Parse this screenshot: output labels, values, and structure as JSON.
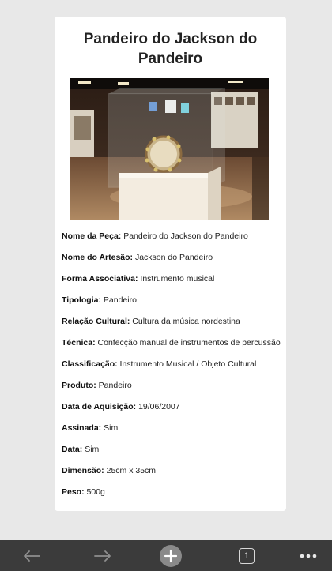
{
  "page": {
    "title": "Pandeiro do Jackson do Pandeiro"
  },
  "photo": {
    "subject": "pandeiro-in-glass-display-case"
  },
  "fields": [
    {
      "label": "Nome da Peça:",
      "value": "Pandeiro do Jackson do Pandeiro"
    },
    {
      "label": "Nome do Artesão:",
      "value": "Jackson do Pandeiro"
    },
    {
      "label": "Forma Associativa:",
      "value": "Instrumento musical"
    },
    {
      "label": "Tipologia:",
      "value": "Pandeiro"
    },
    {
      "label": "Relação Cultural:",
      "value": "Cultura da música nordestina"
    },
    {
      "label": "Técnica:",
      "value": "Confecção manual de instrumentos de percussão"
    },
    {
      "label": "Classificação:",
      "value": "Instrumento Musical / Objeto Cultural"
    },
    {
      "label": "Produto:",
      "value": "Pandeiro"
    },
    {
      "label": "Data de Aquisição:",
      "value": "19/06/2007"
    },
    {
      "label": "Assinada:",
      "value": "Sim"
    },
    {
      "label": "Data:",
      "value": "Sim"
    },
    {
      "label": "Dimensão:",
      "value": "25cm x 35cm"
    },
    {
      "label": "Peso:",
      "value": "500g"
    }
  ],
  "toolbar": {
    "back_icon": "arrow-left-icon",
    "forward_icon": "arrow-right-icon",
    "new_tab_icon": "plus-icon",
    "tab_count": "1",
    "more_icon": "ellipsis-icon"
  },
  "colors": {
    "page_background": "#e8e8e8",
    "card_background": "#ffffff",
    "toolbar_background": "#3b3b3b",
    "toolbar_icon": "#9a9a9a"
  }
}
